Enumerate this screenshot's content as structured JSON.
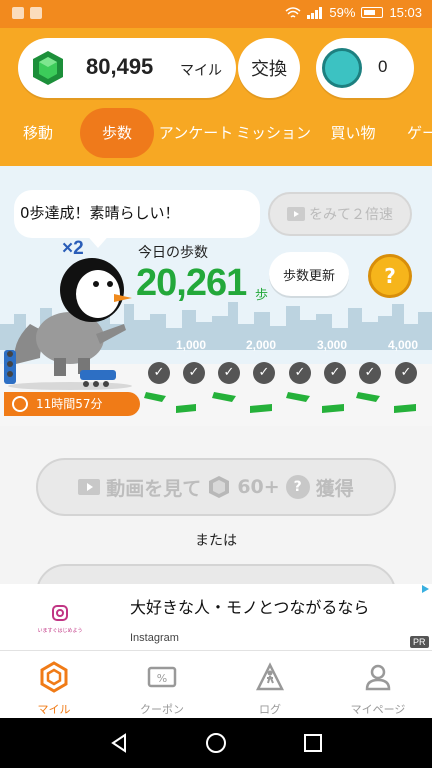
{
  "statusbar": {
    "battery": "59%",
    "time": "15:03"
  },
  "header": {
    "mile_value": "80,495",
    "mile_unit": "マイル",
    "exchange_label": "交換",
    "coin_value": "0",
    "tabs": [
      {
        "label": "移動"
      },
      {
        "label": "歩数",
        "active": true
      },
      {
        "label": "アンケート"
      },
      {
        "label": "ミッション"
      },
      {
        "label": "買い物"
      },
      {
        "label": "ゲー"
      }
    ]
  },
  "scene": {
    "speech": "0歩達成！素晴らしい！",
    "video_button": "をみて２倍速",
    "multiplier": "×2",
    "today_label": "今日の歩数",
    "steps": "20,261",
    "steps_unit": "歩",
    "update_button": "歩数更新",
    "help_button": "?",
    "milestones": [
      "1,000",
      "2,000",
      "3,000",
      "4,000"
    ],
    "checks_completed": 8,
    "timer": "11時間57分"
  },
  "main": {
    "watch_button": {
      "text_a": "動画を見て",
      "amount": "60+",
      "question": "?",
      "text_b": "獲得"
    },
    "or_text": "または"
  },
  "ad": {
    "title": "大好きな人・モノとつながるなら",
    "advertiser": "Instagram",
    "badge": "PR",
    "logo_caption": "いますぐはじめよう"
  },
  "bottom_nav": [
    {
      "label": "マイル",
      "icon": "hexagon-icon",
      "active": true
    },
    {
      "label": "クーポン",
      "icon": "coupon-icon"
    },
    {
      "label": "ログ",
      "icon": "walking-icon"
    },
    {
      "label": "マイページ",
      "icon": "person-icon"
    }
  ],
  "colors": {
    "header": "#f7a823",
    "accent": "#f07b17",
    "steps_green": "#23a83a",
    "scene_bg": "#e9f3f9"
  }
}
